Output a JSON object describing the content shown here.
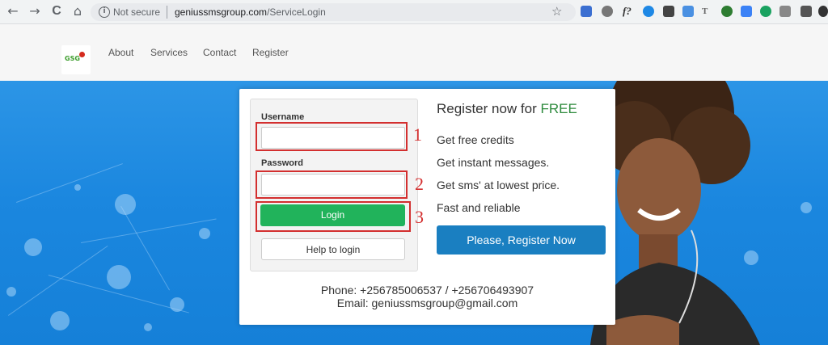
{
  "browser": {
    "security_label": "Not secure",
    "url_host": "geniussmsgroup.com",
    "url_path": "/ServiceLogin",
    "back_icon": "←",
    "forward_icon": "→",
    "reload_icon": "C",
    "home_icon": "⌂",
    "star_icon": "☆"
  },
  "site": {
    "logo_text": "GSG",
    "nav": [
      "About",
      "Services",
      "Contact",
      "Register"
    ]
  },
  "login": {
    "username_label": "Username",
    "password_label": "Password",
    "login_button": "Login",
    "help_button": "Help to login",
    "annotations": [
      "1",
      "2",
      "3"
    ]
  },
  "register": {
    "title_prefix": "Register now for ",
    "title_highlight": "FREE",
    "features": [
      "Get free credits",
      "Get instant messages.",
      "Get sms' at lowest price.",
      "Fast and reliable"
    ],
    "button": "Please, Register Now"
  },
  "contact": {
    "phone": "Phone: +256785006537 / +256706493907",
    "email": "Email: geniussmsgroup@gmail.com"
  },
  "colors": {
    "hero_blue": "#1b87df",
    "login_green": "#21b35b",
    "register_blue": "#1a7fc1",
    "annotation_red": "#d32f2f",
    "free_green": "#2e8b3d"
  }
}
